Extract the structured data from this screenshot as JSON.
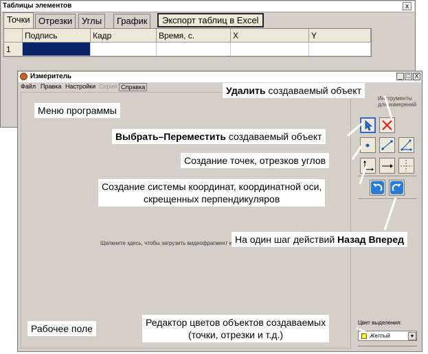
{
  "tables_window": {
    "title": "Таблицы элементов",
    "close_glyph": "x",
    "tabs": [
      "Точки",
      "Отрезки",
      "Углы",
      "График"
    ],
    "export_button": "Экспорт таблиц в  Excel",
    "columns": [
      "Подпись",
      "Кадр",
      "Время, с.",
      "X",
      "Y"
    ],
    "rows": [
      {
        "number": "1",
        "cells": [
          "",
          "",
          "",
          "",
          ""
        ]
      }
    ]
  },
  "app_window": {
    "title": "Измеритель",
    "window_controls": [
      "_",
      "□",
      "X"
    ],
    "menu": [
      "Файл",
      "Правка",
      "Настройки",
      "Серия",
      "Справка"
    ],
    "workarea_hint": "Щелкните здесь, чтобы загрузить видеофрагмент или изображение",
    "toolpanel_title": "Инструменты для измерений",
    "tools": [
      "select-move",
      "delete",
      "point",
      "segment",
      "angle",
      "coordinate-system",
      "coordinate-axis",
      "crossed-perpendiculars",
      "undo",
      "redo"
    ],
    "color_label": "Цвет выделения:",
    "color_value": "Желтый",
    "color_swatch": "#ffff00",
    "accent_selected_cell": "#0a246a"
  },
  "callouts": {
    "menu": "Меню программы",
    "delete_bold": "Удалить",
    "delete_rest": " создаваемый объект",
    "select_bold": "Выбрать–Переместить",
    "select_rest": " создаваемый объект",
    "create": "Создание точек, отрезков углов",
    "coords_line1": "Создание системы координат, координатной оси,",
    "coords_line2": "скрещенных перпендикуляров",
    "undo_prefix": "На один шаг действий ",
    "undo_bold": "Назад Вперед",
    "workfield": "Рабочее поле",
    "colors_line1": "Редактор цветов объектов создаваемых",
    "colors_line2": "(точки, отрезки и т.д.)"
  }
}
